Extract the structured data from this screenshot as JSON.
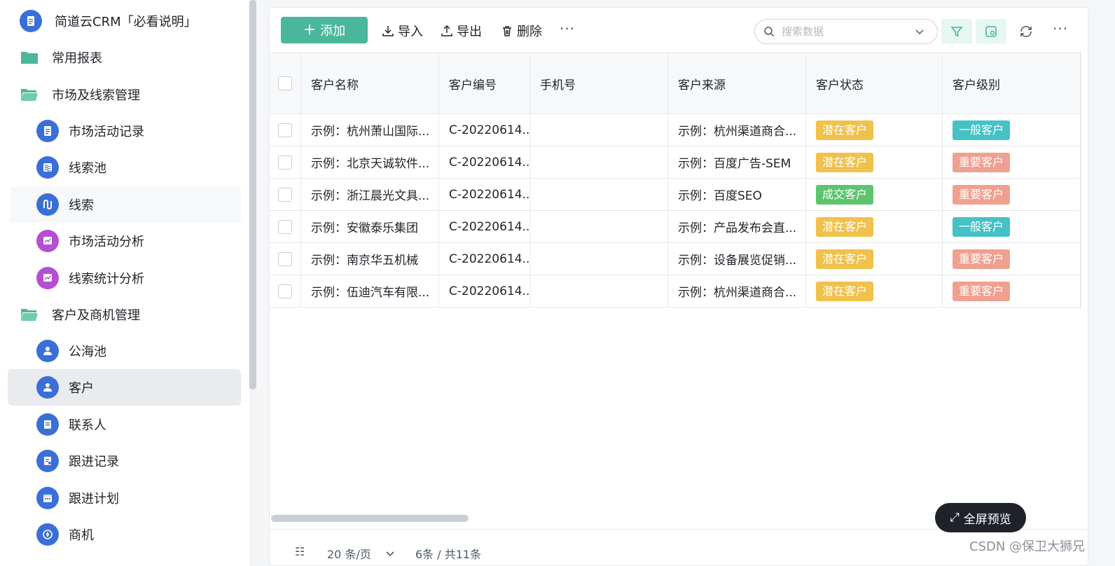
{
  "sidebar": {
    "items": [
      {
        "label": "简道云CRM「必看说明」",
        "icon": "document-icon"
      },
      {
        "label": "常用报表",
        "icon": "folder-icon"
      },
      {
        "label": "市场及线索管理",
        "icon": "folder-open-icon"
      },
      {
        "label": "市场活动记录",
        "icon": "document-icon"
      },
      {
        "label": "线索池",
        "icon": "waves-icon"
      },
      {
        "label": "线索",
        "icon": "flow-icon"
      },
      {
        "label": "市场活动分析",
        "icon": "chart-icon"
      },
      {
        "label": "线索统计分析",
        "icon": "chart-icon"
      },
      {
        "label": "客户及商机管理",
        "icon": "folder-open-icon"
      },
      {
        "label": "公海池",
        "icon": "user-icon"
      },
      {
        "label": "客户",
        "icon": "user-icon"
      },
      {
        "label": "联系人",
        "icon": "contact-book-icon"
      },
      {
        "label": "跟进记录",
        "icon": "record-icon"
      },
      {
        "label": "跟进计划",
        "icon": "calendar-icon"
      },
      {
        "label": "商机",
        "icon": "compass-icon"
      }
    ]
  },
  "toolbar": {
    "add_label": "添加",
    "import_label": "导入",
    "export_label": "导出",
    "delete_label": "删除",
    "more_label": "···",
    "search_placeholder": "搜索数据",
    "more_right_label": "···"
  },
  "table": {
    "columns": [
      "客户名称",
      "客户编号",
      "手机号",
      "客户来源",
      "客户状态",
      "客户级别"
    ],
    "rows": [
      {
        "name": "示例：杭州萧山国际...",
        "code": "C-20220614...",
        "phone": "",
        "source": "示例：杭州渠道商合...",
        "status": "潜在客户",
        "level": "一般客户"
      },
      {
        "name": "示例：北京天诚软件...",
        "code": "C-20220614...",
        "phone": "",
        "source": "示例：百度广告-SEM",
        "status": "潜在客户",
        "level": "重要客户"
      },
      {
        "name": "示例：浙江晨光文具...",
        "code": "C-20220614...",
        "phone": "",
        "source": "示例：百度SEO",
        "status": "成交客户",
        "level": "重要客户"
      },
      {
        "name": "示例：安徽泰乐集团",
        "code": "C-20220614...",
        "phone": "",
        "source": "示例：产品发布会直...",
        "status": "潜在客户",
        "level": "一般客户"
      },
      {
        "name": "示例：南京华五机械",
        "code": "C-20220614...",
        "phone": "",
        "source": "示例：设备展览促销...",
        "status": "潜在客户",
        "level": "重要客户"
      },
      {
        "name": "示例：伍迪汽车有限...",
        "code": "C-20220614...",
        "phone": "",
        "source": "示例：杭州渠道商合...",
        "status": "潜在客户",
        "level": "重要客户"
      }
    ]
  },
  "colors": {
    "潜在客户": "#f0c14b",
    "成交客户": "#5ec46f",
    "一般客户": "#46c1c5",
    "重要客户": "#f0a090",
    "accent": "#4bb79a"
  },
  "footer": {
    "page_size": "20 条/页",
    "count": "6条 / 共11条"
  },
  "fullscreen_label": "全屏预览",
  "watermark": "CSDN @保卫大狮兄"
}
